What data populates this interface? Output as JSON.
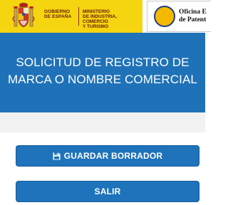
{
  "header": {
    "gov_line1": "GOBIERNO",
    "gov_line2": "DE ESPAÑA",
    "ministry_line1": "MINISTERIO",
    "ministry_line2": "DE INDUSTRIA, COMERCIO",
    "ministry_line3": "Y TURISMO",
    "oepm_line1": "Oficina E",
    "oepm_line2": "de Patent"
  },
  "banner": {
    "title_line1": "SOLICITUD DE REGISTRO DE",
    "title_line2": "MARCA O NOMBRE COMERCIAL"
  },
  "actions": {
    "save_draft_label": "GUARDAR BORRADOR",
    "exit_label": "SALIR"
  },
  "icons": {
    "save": "floppy-disk-icon",
    "coat_of_arms": "coat-of-arms-icon",
    "oepm_logo": "oepm-logo-icon"
  },
  "colors": {
    "gov_yellow": "#f5d410",
    "banner_blue": "#1f72b8",
    "button_blue": "#1e73bb",
    "oepm_gold": "#f5b800"
  }
}
